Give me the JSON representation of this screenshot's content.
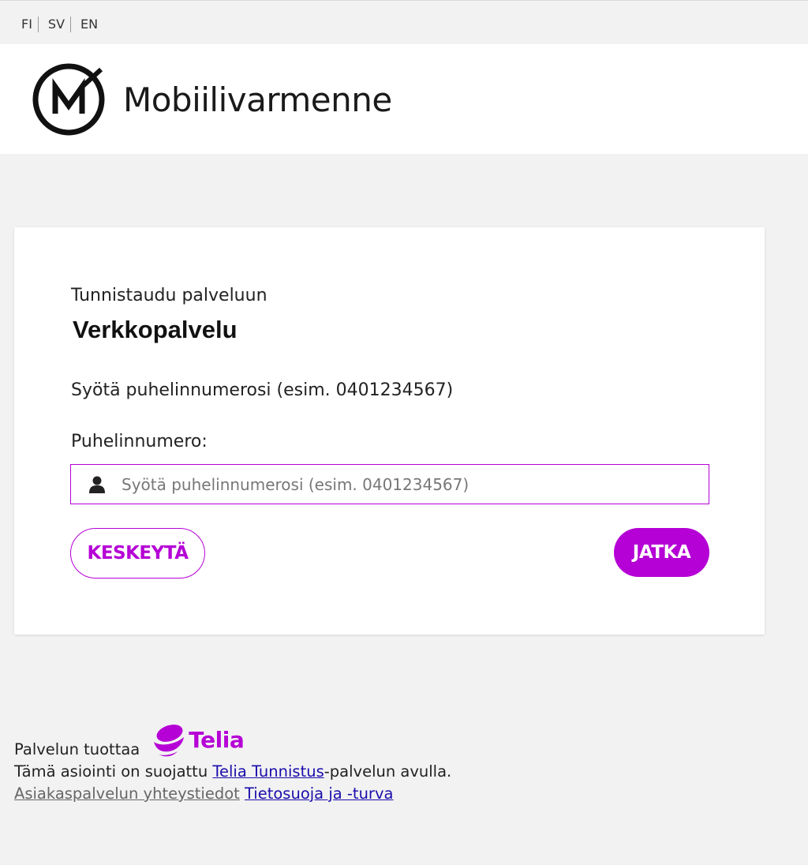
{
  "languages": [
    "FI",
    "SV",
    "EN"
  ],
  "header": {
    "brand": "Mobiilivarmenne"
  },
  "card": {
    "subtitle": "Tunnistaudu palveluun",
    "service_name": "Verkkopalvelu",
    "instruction": "Syötä puhelinnumerosi (esim. 0401234567)",
    "field_label": "Puhelinnumero:",
    "phone_input": {
      "value": "",
      "placeholder": "Syötä puhelinnumerosi (esim. 0401234567)"
    },
    "cancel_label": "KESKEYTÄ",
    "continue_label": "JATKA"
  },
  "footer": {
    "provided_by": "Palvelun tuottaa",
    "provider_logo_text": "Telia",
    "protected_prefix": "Tämä asiointi on suojattu ",
    "protected_link": "Telia Tunnistus",
    "protected_suffix": "-palvelun avulla.",
    "customer_service_link": "Asiakaspalvelun yhteystiedot",
    "privacy_link": "Tietosuoja ja -turva"
  },
  "colors": {
    "accent": "#b500d6",
    "link": "#1a0dab",
    "background": "#f2f2f2"
  }
}
